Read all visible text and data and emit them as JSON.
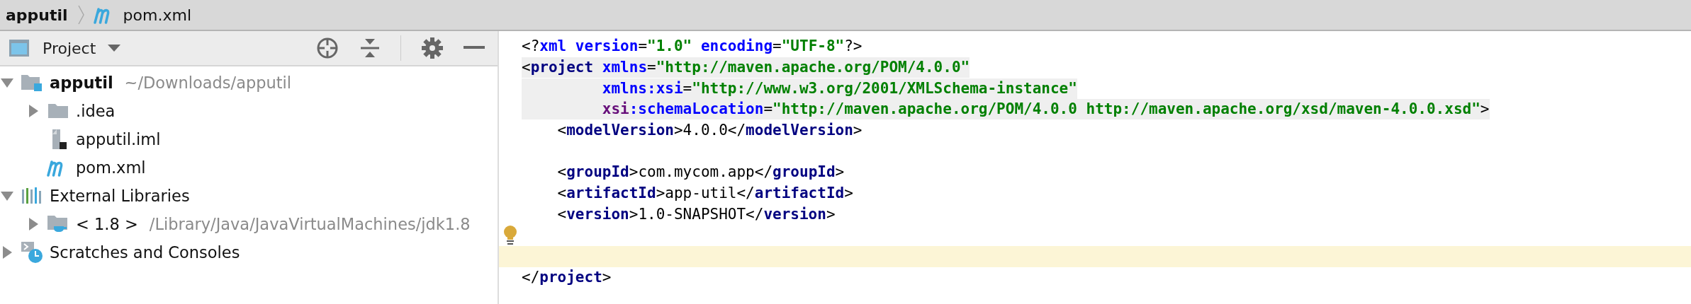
{
  "breadcrumb": [
    {
      "label": "apputil",
      "kind": "plain",
      "bold": true
    },
    {
      "label": "pom.xml",
      "kind": "maven",
      "bold": false
    }
  ],
  "project_panel": {
    "title": "Project",
    "tree": [
      {
        "label": "apputil",
        "path": "~/Downloads/apputil",
        "kind": "module",
        "bold": true,
        "expanded": true,
        "children": [
          {
            "label": ".idea",
            "kind": "folder",
            "bold": false,
            "expanded": false
          },
          {
            "label": "apputil.iml",
            "kind": "iml",
            "bold": false
          },
          {
            "label": "pom.xml",
            "kind": "maven",
            "bold": false
          }
        ]
      },
      {
        "label": "External Libraries",
        "kind": "libraries",
        "bold": false,
        "expanded": true,
        "children": [
          {
            "label": "< 1.8 >",
            "path": "/Library/Java/JavaVirtualMachines/jdk1.8",
            "kind": "jdk",
            "bold": false,
            "expanded": false
          }
        ]
      },
      {
        "label": "Scratches and Consoles",
        "kind": "scratches",
        "bold": false,
        "expanded": false
      }
    ]
  },
  "editor": {
    "lines": [
      {
        "matched": false,
        "current": false,
        "bulb": false,
        "tokens": [
          {
            "kind": "punct",
            "text": "<?"
          },
          {
            "kind": "attr",
            "text": "xml version"
          },
          {
            "kind": "punct",
            "text": "="
          },
          {
            "kind": "value",
            "text": "\"1.0\" "
          },
          {
            "kind": "attr",
            "text": "encoding"
          },
          {
            "kind": "punct",
            "text": "="
          },
          {
            "kind": "value",
            "text": "\"UTF-8\""
          },
          {
            "kind": "punct",
            "text": "?>"
          }
        ]
      },
      {
        "matched": true,
        "current": false,
        "bulb": false,
        "tokens": [
          {
            "kind": "punct",
            "text": "<"
          },
          {
            "kind": "tag",
            "text": "project "
          },
          {
            "kind": "attr",
            "text": "xmlns"
          },
          {
            "kind": "punct",
            "text": "="
          },
          {
            "kind": "value",
            "text": "\"http://maven.apache.org/POM/4.0.0\""
          }
        ]
      },
      {
        "matched": true,
        "current": false,
        "bulb": false,
        "tokens": [
          {
            "kind": "attr",
            "text": "         xmlns:xsi"
          },
          {
            "kind": "punct",
            "text": "="
          },
          {
            "kind": "value",
            "text": "\"http://www.w3.org/2001/XMLSchema-instance\""
          }
        ]
      },
      {
        "matched": true,
        "current": false,
        "bulb": false,
        "tokens": [
          {
            "kind": "ns",
            "text": "         xsi"
          },
          {
            "kind": "attr",
            "text": ":schemaLocation"
          },
          {
            "kind": "punct",
            "text": "="
          },
          {
            "kind": "value",
            "text": "\"http://maven.apache.org/POM/4.0.0 http://maven.apache.org/xsd/maven-4.0.0.xsd\""
          },
          {
            "kind": "punct",
            "text": ">"
          }
        ]
      },
      {
        "matched": false,
        "current": false,
        "bulb": false,
        "tokens": [
          {
            "kind": "punct",
            "text": "    <"
          },
          {
            "kind": "tag",
            "text": "modelVersion"
          },
          {
            "kind": "punct",
            "text": ">"
          },
          {
            "kind": "plain",
            "text": "4.0.0"
          },
          {
            "kind": "punct",
            "text": "</"
          },
          {
            "kind": "tag",
            "text": "modelVersion"
          },
          {
            "kind": "punct",
            "text": ">"
          }
        ]
      },
      {
        "current": false,
        "bulb": false
      },
      {
        "matched": false,
        "current": false,
        "bulb": false,
        "tokens": [
          {
            "kind": "punct",
            "text": "    <"
          },
          {
            "kind": "tag",
            "text": "groupId"
          },
          {
            "kind": "punct",
            "text": ">"
          },
          {
            "kind": "plain",
            "text": "com.mycom.app"
          },
          {
            "kind": "punct",
            "text": "</"
          },
          {
            "kind": "tag",
            "text": "groupId"
          },
          {
            "kind": "punct",
            "text": ">"
          }
        ]
      },
      {
        "matched": false,
        "current": false,
        "bulb": false,
        "tokens": [
          {
            "kind": "punct",
            "text": "    <"
          },
          {
            "kind": "tag",
            "text": "artifactId"
          },
          {
            "kind": "punct",
            "text": ">"
          },
          {
            "kind": "plain",
            "text": "app-util"
          },
          {
            "kind": "punct",
            "text": "</"
          },
          {
            "kind": "tag",
            "text": "artifactId"
          },
          {
            "kind": "punct",
            "text": ">"
          }
        ]
      },
      {
        "matched": false,
        "current": false,
        "bulb": false,
        "tokens": [
          {
            "kind": "punct",
            "text": "    <"
          },
          {
            "kind": "tag",
            "text": "version"
          },
          {
            "kind": "punct",
            "text": ">"
          },
          {
            "kind": "plain",
            "text": "1.0-SNAPSHOT"
          },
          {
            "kind": "punct",
            "text": "</"
          },
          {
            "kind": "tag",
            "text": "version"
          },
          {
            "kind": "punct",
            "text": ">"
          }
        ]
      },
      {
        "current": false,
        "bulb": true
      },
      {
        "current": true,
        "bulb": false
      },
      {
        "matched": false,
        "current": false,
        "bulb": false,
        "tokens": [
          {
            "kind": "punct",
            "text": "</"
          },
          {
            "kind": "tag",
            "text": "project"
          },
          {
            "kind": "punct",
            "text": ">"
          }
        ]
      }
    ]
  }
}
